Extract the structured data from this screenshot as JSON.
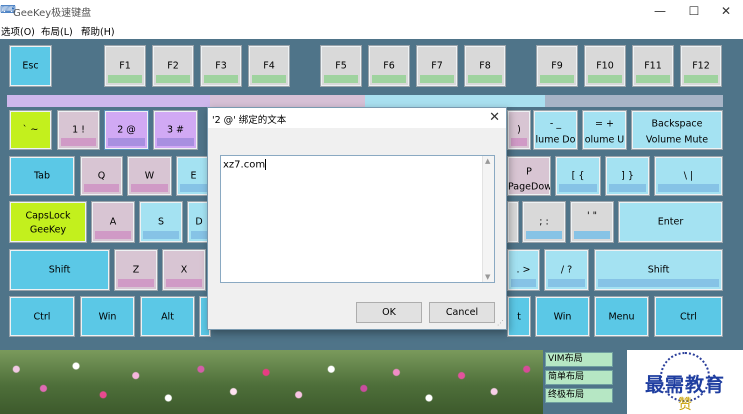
{
  "window": {
    "title": "GeeKey极速键盘",
    "app_icon": "keyboard-icon",
    "minimize": "—",
    "maximize": "☐",
    "close": "✕"
  },
  "menu": [
    "选项(O)",
    "布局(L)",
    "帮助(H)"
  ],
  "keyboard": {
    "function_row": [
      "Esc",
      "F1",
      "F2",
      "F3",
      "F4",
      "F5",
      "F6",
      "F7",
      "F8",
      "F9",
      "F10",
      "F11",
      "F12"
    ],
    "number_row": [
      "` ~",
      "1 !",
      "2 @",
      "3 #",
      ")",
      "- _",
      "lume Do",
      "= +",
      "olume U",
      "Backspace",
      "Volume Mute"
    ],
    "tab_row": [
      "Tab",
      "Q",
      "W",
      "E",
      "P",
      "PageDown",
      "[ {",
      "] }",
      "\\ |"
    ],
    "caps_row": [
      "CapsLock",
      "GeeKey",
      "A",
      "S",
      "D",
      "; :",
      "' \"",
      "Enter"
    ],
    "shift_row": [
      "Shift",
      "Z",
      "X",
      ". >",
      "/ ?",
      "Shift"
    ],
    "bottom_row": [
      "Ctrl",
      "Win",
      "Alt",
      "t",
      "Win",
      "Menu",
      "Ctrl"
    ]
  },
  "dialog": {
    "title": "'2  @' 绑定的文本",
    "close": "✕",
    "text": "xz7.com",
    "ok": "OK",
    "cancel": "Cancel",
    "grip": "⋰"
  },
  "layouts": [
    "VIM布局",
    "简单布局",
    "终极布局"
  ],
  "watermark": {
    "text": "最需教育",
    "badge": "赞"
  }
}
